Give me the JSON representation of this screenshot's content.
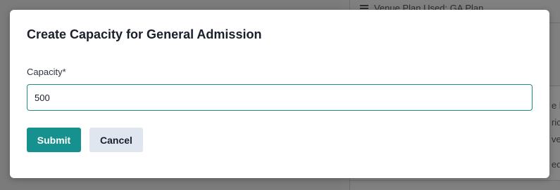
{
  "background": {
    "venue_plan_text": "Venue Plan Used: GA Plan",
    "card_fragments": [
      "e ba",
      "ric",
      "ver",
      "ed"
    ]
  },
  "modal": {
    "title": "Create Capacity for General Admission",
    "capacity_label": "Capacity*",
    "capacity_value": "500",
    "submit_label": "Submit",
    "cancel_label": "Cancel"
  },
  "colors": {
    "accent": "#16918f",
    "input_border": "#1d8c8a",
    "cancel_bg": "#dfe6ef"
  }
}
